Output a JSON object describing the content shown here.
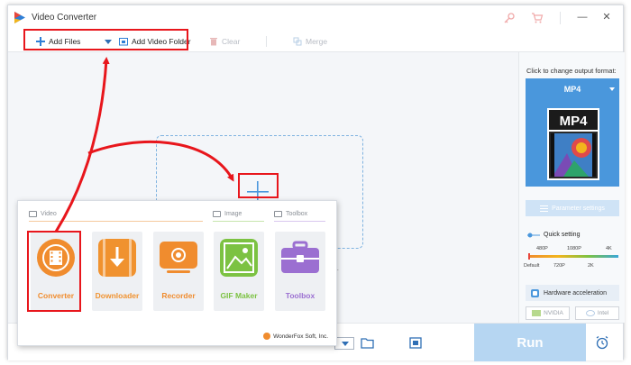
{
  "app": {
    "title": "Video Converter",
    "window_buttons": [
      "—",
      "✕"
    ]
  },
  "toolbar": {
    "add_files": "Add Files",
    "add_video_folder": "Add Video Folder",
    "clear": "Clear",
    "merge": "Merge"
  },
  "right_panel": {
    "hint": "Click to change output format:",
    "format": "MP4",
    "parameter_settings": "Parameter settings",
    "quick_setting": "Quick setting",
    "quality_top": [
      "480P",
      "1080P",
      "4K"
    ],
    "quality_bottom": [
      "Default",
      "720P",
      "2K"
    ],
    "hardware_acceleration": "Hardware acceleration",
    "gpu_chips": [
      "NVIDIA",
      "Intel"
    ]
  },
  "main": {
    "drop_hint_visible": "p."
  },
  "bottom": {
    "run": "Run"
  },
  "feature_panel": {
    "sections": {
      "video": "Video",
      "image": "Image",
      "toolbox": "Toolbox"
    },
    "tiles": [
      {
        "label": "Converter",
        "color": "#f08c2e"
      },
      {
        "label": "Downloader",
        "color": "#f0922f"
      },
      {
        "label": "Recorder",
        "color": "#f08c2e"
      },
      {
        "label": "GIF Maker",
        "color": "#7cc242"
      },
      {
        "label": "Toolbox",
        "color": "#9b6fd1"
      }
    ],
    "brand": "WonderFox Soft, Inc."
  },
  "colors": {
    "accent_blue": "#4a97dc",
    "annotation_red": "#e8161c",
    "orange": "#f08c2e",
    "green": "#7cc242",
    "purple": "#9b6fd1"
  }
}
